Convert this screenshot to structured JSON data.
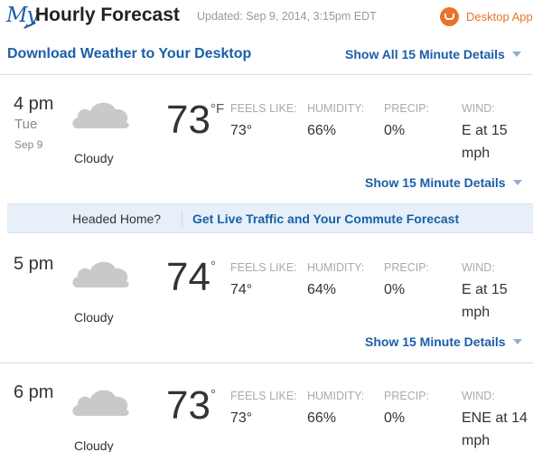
{
  "header": {
    "logo": "My",
    "title": "Hourly Forecast",
    "updated": "Updated: Sep 9, 2014, 3:15pm EDT",
    "desktop_app": "Desktop App"
  },
  "toolbar": {
    "download": "Download Weather to Your Desktop",
    "show_all": "Show All 15 Minute Details"
  },
  "labels": {
    "feels_like": "FEELS LIKE:",
    "humidity": "HUMIDITY:",
    "precip": "PRECIP:",
    "wind": "WIND:",
    "show_15": "Show 15 Minute Details"
  },
  "hours": [
    {
      "time": "4 pm",
      "day": "Tue",
      "date": "Sep 9",
      "condition": "Cloudy",
      "temp": "73",
      "unit": "°F",
      "feels_like": "73°",
      "humidity": "66%",
      "precip": "0%",
      "wind": "E at 15 mph"
    },
    {
      "time": "5 pm",
      "condition": "Cloudy",
      "temp": "74",
      "unit": "°",
      "feels_like": "74°",
      "humidity": "64%",
      "precip": "0%",
      "wind": "E at 15 mph"
    },
    {
      "time": "6 pm",
      "condition": "Cloudy",
      "temp": "73",
      "unit": "°",
      "feels_like": "73°",
      "humidity": "66%",
      "precip": "0%",
      "wind": "ENE at 14 mph"
    }
  ],
  "banner": {
    "question": "Headed Home?",
    "link": "Get Live Traffic and Your Commute Forecast"
  },
  "colors": {
    "accent": "#1a5fa8",
    "brand_orange": "#e8742a",
    "banner_bg": "#e7f0f8"
  }
}
